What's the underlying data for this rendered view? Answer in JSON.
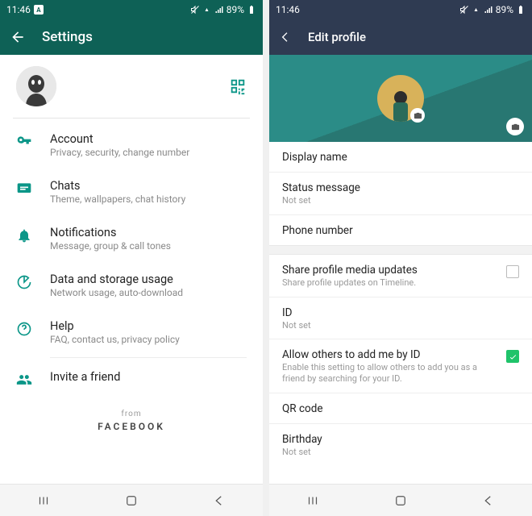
{
  "status": {
    "time": "11:46",
    "battery": "89%",
    "badge": "A"
  },
  "left": {
    "header": {
      "title": "Settings"
    },
    "items": [
      {
        "icon": "key",
        "title": "Account",
        "sub": "Privacy, security, change number"
      },
      {
        "icon": "chat",
        "title": "Chats",
        "sub": "Theme, wallpapers, chat history"
      },
      {
        "icon": "bell",
        "title": "Notifications",
        "sub": "Message, group & call tones"
      },
      {
        "icon": "data",
        "title": "Data and storage usage",
        "sub": "Network usage, auto-download"
      },
      {
        "icon": "help",
        "title": "Help",
        "sub": "FAQ, contact us, privacy policy"
      },
      {
        "icon": "invite",
        "title": "Invite a friend",
        "sub": ""
      }
    ],
    "from": {
      "label": "from",
      "brand": "FACEBOOK"
    }
  },
  "right": {
    "header": {
      "title": "Edit profile"
    },
    "rows": {
      "display_name": {
        "label": "Display name"
      },
      "status_msg": {
        "label": "Status message",
        "sub": "Not set"
      },
      "phone": {
        "label": "Phone number"
      },
      "share": {
        "label": "Share profile media updates",
        "sub": "Share profile updates on Timeline.",
        "checked": false
      },
      "id": {
        "label": "ID",
        "sub": "Not set"
      },
      "allow_add": {
        "label": "Allow others to add me by ID",
        "sub": "Enable this setting to allow others to add you as a friend by searching for your ID.",
        "checked": true
      },
      "qr": {
        "label": "QR code"
      },
      "birthday": {
        "label": "Birthday",
        "sub": "Not set"
      }
    }
  }
}
